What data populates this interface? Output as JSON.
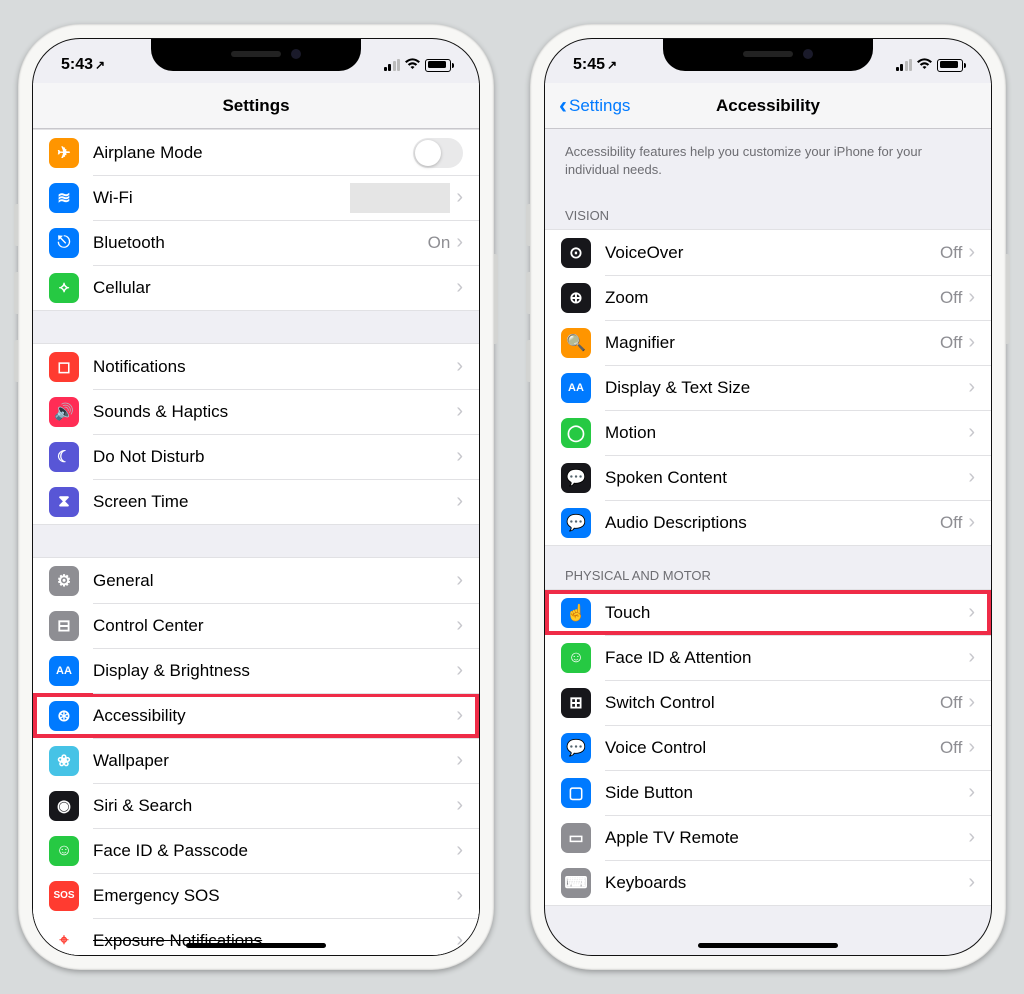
{
  "left": {
    "time": "5:43",
    "title": "Settings",
    "groups": [
      {
        "rows": [
          {
            "id": "airplane",
            "icon": "✈",
            "bg": "#ff9500",
            "label": "Airplane Mode",
            "toggle": true
          },
          {
            "id": "wifi",
            "icon": "≋",
            "bg": "#007aff",
            "label": "Wi-Fi",
            "redacted": true,
            "chevron": true
          },
          {
            "id": "bluetooth",
            "icon": "⎋",
            "bg": "#007aff",
            "label": "Bluetooth",
            "value": "On",
            "chevron": true
          },
          {
            "id": "cellular",
            "icon": "⟡",
            "bg": "#26c943",
            "label": "Cellular",
            "chevron": true
          }
        ]
      },
      {
        "rows": [
          {
            "id": "notifications",
            "icon": "◻",
            "bg": "#ff3b30",
            "label": "Notifications",
            "chevron": true
          },
          {
            "id": "sounds",
            "icon": "🔊",
            "bg": "#ff2d55",
            "label": "Sounds & Haptics",
            "chevron": true
          },
          {
            "id": "dnd",
            "icon": "☾",
            "bg": "#5856d6",
            "label": "Do Not Disturb",
            "chevron": true
          },
          {
            "id": "screentime",
            "icon": "⧗",
            "bg": "#5856d6",
            "label": "Screen Time",
            "chevron": true
          }
        ]
      },
      {
        "rows": [
          {
            "id": "general",
            "icon": "⚙",
            "bg": "#8e8e93",
            "label": "General",
            "chevron": true
          },
          {
            "id": "controlcenter",
            "icon": "⊟",
            "bg": "#8e8e93",
            "label": "Control Center",
            "chevron": true
          },
          {
            "id": "display",
            "icon": "AA",
            "bg": "#007aff",
            "textsize": "11px",
            "label": "Display & Brightness",
            "chevron": true
          },
          {
            "id": "accessibility",
            "icon": "⊛",
            "bg": "#007aff",
            "label": "Accessibility",
            "chevron": true,
            "highlight": true
          },
          {
            "id": "wallpaper",
            "icon": "❀",
            "bg": "#46c3e6",
            "label": "Wallpaper",
            "chevron": true
          },
          {
            "id": "siri",
            "icon": "◉",
            "bg": "#17171b",
            "label": "Siri & Search",
            "chevron": true
          },
          {
            "id": "faceid",
            "icon": "☺",
            "bg": "#26c943",
            "label": "Face ID & Passcode",
            "chevron": true
          },
          {
            "id": "sos",
            "icon": "SOS",
            "bg": "#ff3b30",
            "textsize": "10px",
            "label": "Emergency SOS",
            "chevron": true
          },
          {
            "id": "exposure",
            "icon": "⌖",
            "bg": "#fff",
            "fg": "#ff3b30",
            "label": "Exposure Notifications",
            "chevron": true,
            "strike": true
          }
        ]
      }
    ]
  },
  "right": {
    "time": "5:45",
    "title": "Accessibility",
    "back": "Settings",
    "desc": "Accessibility features help you customize your iPhone for your individual needs.",
    "groups": [
      {
        "header": "VISION",
        "rows": [
          {
            "id": "voiceover",
            "icon": "⊙",
            "bg": "#17171b",
            "label": "VoiceOver",
            "value": "Off",
            "chevron": true
          },
          {
            "id": "zoom",
            "icon": "⊕",
            "bg": "#17171b",
            "label": "Zoom",
            "value": "Off",
            "chevron": true
          },
          {
            "id": "magnifier",
            "icon": "🔍",
            "bg": "#ff9500",
            "label": "Magnifier",
            "value": "Off",
            "chevron": true
          },
          {
            "id": "textsize",
            "icon": "AA",
            "bg": "#007aff",
            "textsize": "11px",
            "label": "Display & Text Size",
            "chevron": true
          },
          {
            "id": "motion",
            "icon": "◯",
            "bg": "#26c943",
            "label": "Motion",
            "chevron": true
          },
          {
            "id": "spoken",
            "icon": "💬",
            "bg": "#17171b",
            "label": "Spoken Content",
            "chevron": true
          },
          {
            "id": "audiodesc",
            "icon": "💬",
            "bg": "#007aff",
            "label": "Audio Descriptions",
            "value": "Off",
            "chevron": true
          }
        ]
      },
      {
        "header": "PHYSICAL AND MOTOR",
        "rows": [
          {
            "id": "touch",
            "icon": "☝",
            "bg": "#007aff",
            "label": "Touch",
            "chevron": true,
            "highlight": true
          },
          {
            "id": "faceattention",
            "icon": "☺",
            "bg": "#26c943",
            "label": "Face ID & Attention",
            "chevron": true
          },
          {
            "id": "switchcontrol",
            "icon": "⊞",
            "bg": "#17171b",
            "label": "Switch Control",
            "value": "Off",
            "chevron": true
          },
          {
            "id": "voicecontrol",
            "icon": "💬",
            "bg": "#007aff",
            "label": "Voice Control",
            "value": "Off",
            "chevron": true
          },
          {
            "id": "sidebutton",
            "icon": "▢",
            "bg": "#007aff",
            "label": "Side Button",
            "chevron": true
          },
          {
            "id": "appletv",
            "icon": "▭",
            "bg": "#8e8e93",
            "label": "Apple TV Remote",
            "chevron": true
          },
          {
            "id": "keyboards",
            "icon": "⌨",
            "bg": "#8e8e93",
            "label": "Keyboards",
            "chevron": true
          }
        ]
      }
    ]
  }
}
